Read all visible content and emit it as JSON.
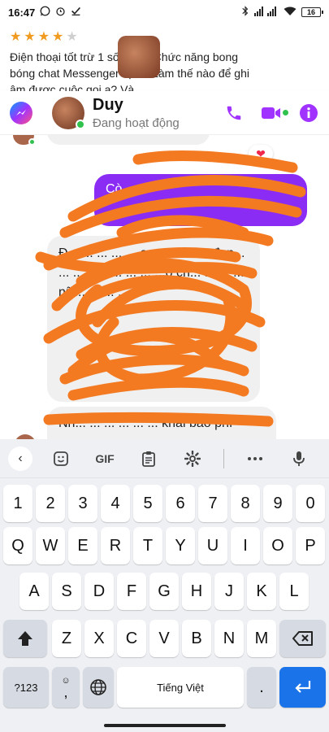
{
  "status_bar": {
    "time": "16:47",
    "battery": "16",
    "left_icons": [
      "whatsapp-icon",
      "alarm-icon",
      "check-icon"
    ],
    "right_icons": [
      "bluetooth-icon",
      "signal-icon",
      "wifi-icon",
      "battery-icon"
    ]
  },
  "review": {
    "rating": 4,
    "max_rating": 5,
    "text": "Điện thoại tốt trừ 1 số điểm. Chức năng bong bóng chat Messenger bị lỗi. Làm thế nào để ghi âm được cuộc gọi ạ? Và"
  },
  "chat_header": {
    "contact_name": "Duy",
    "contact_status": "Đang hoạt động",
    "status_color": "#31c24d",
    "accent_color": "#a033ff"
  },
  "messages": {
    "reaction": "❤",
    "outgoing_partial": "Cò...",
    "incoming_partial": "Đ... ... ... ... ... au... ... ... ... đan... ... ... Nen... ... ... ...o ch... ... ... ... nữ... ... ... ...",
    "incoming_partial_2": "Nh... ... ... ... ... ... khai báo phí"
  },
  "keyboard": {
    "toolbar": {
      "back": "‹",
      "gif": "GIF",
      "icons": [
        "sticker-icon",
        "clipboard-icon",
        "settings-icon",
        "more-icon",
        "mic-icon"
      ]
    },
    "row_numbers": [
      "1",
      "2",
      "3",
      "4",
      "5",
      "6",
      "7",
      "8",
      "9",
      "0"
    ],
    "row_1": [
      "Q",
      "W",
      "E",
      "R",
      "T",
      "Y",
      "U",
      "I",
      "O",
      "P"
    ],
    "row_2": [
      "A",
      "S",
      "D",
      "F",
      "G",
      "H",
      "J",
      "K",
      "L"
    ],
    "row_3": [
      "Z",
      "X",
      "C",
      "V",
      "B",
      "N",
      "M"
    ],
    "symbols_label": "?123",
    "space_label": "Tiếng Việt",
    "period": ".",
    "comma": ","
  }
}
